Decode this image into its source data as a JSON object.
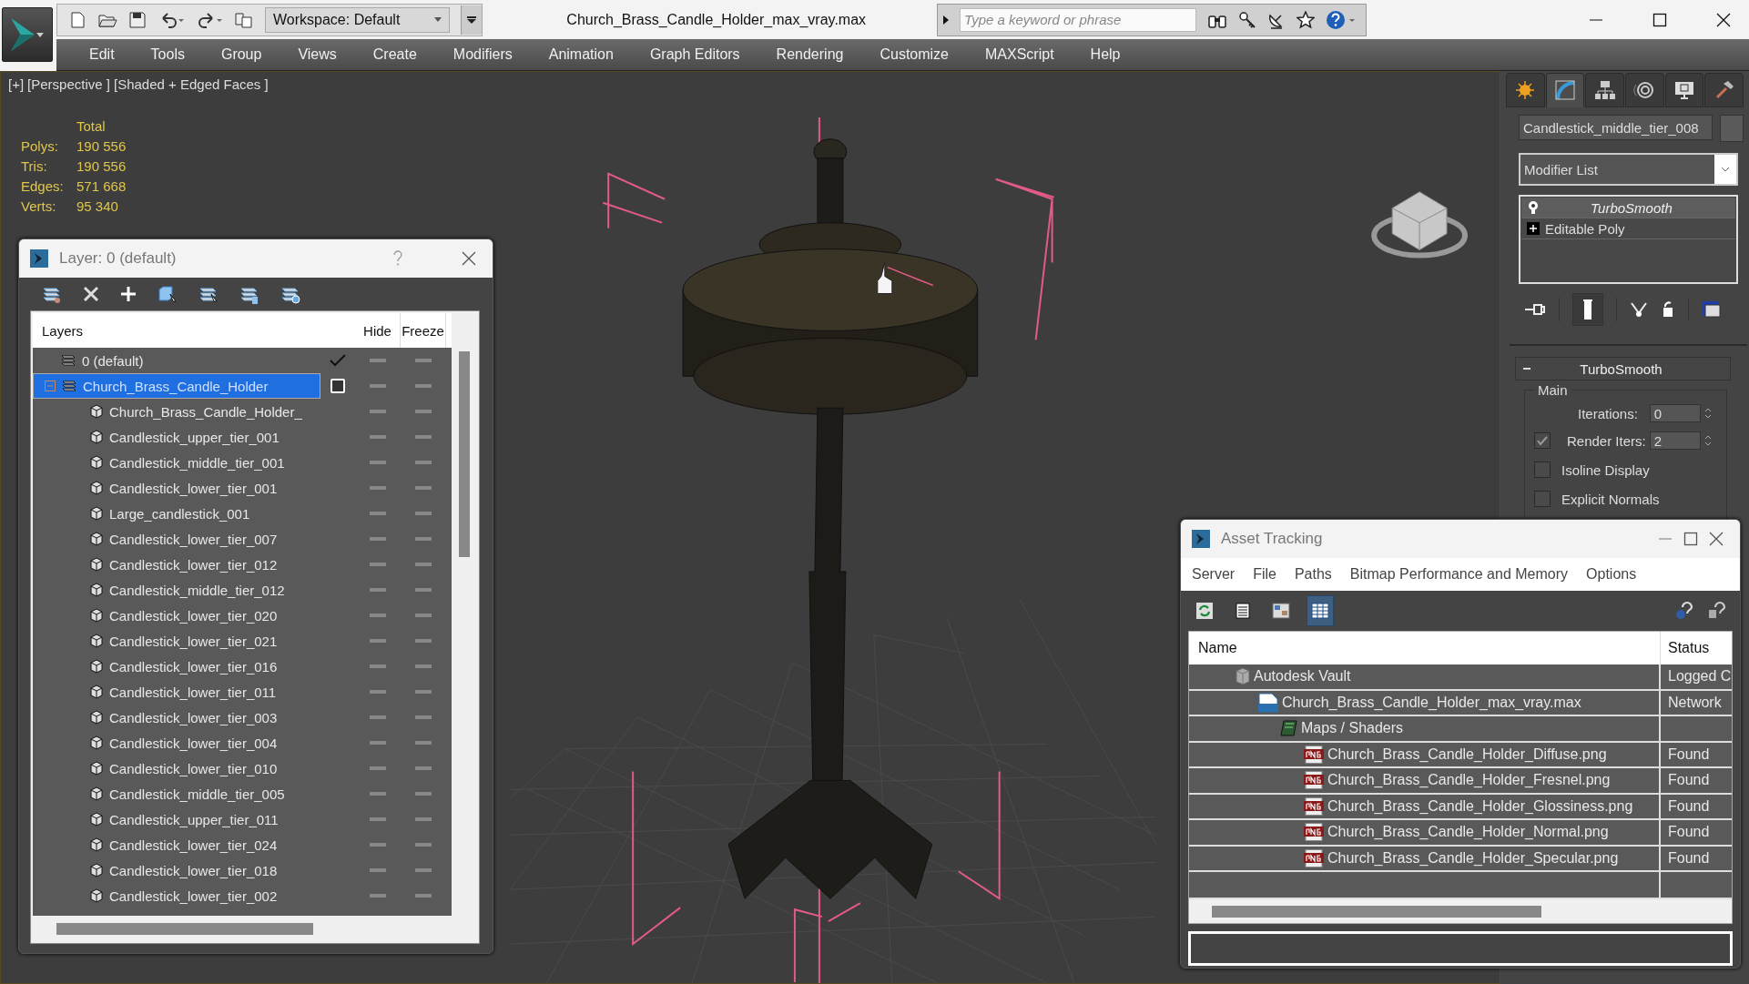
{
  "title_bar": {
    "workspace": "Workspace: Default",
    "title": "Church_Brass_Candle_Holder_max_vray.max",
    "search_placeholder": "Type a keyword or phrase"
  },
  "menu": [
    "Edit",
    "Tools",
    "Group",
    "Views",
    "Create",
    "Modifiers",
    "Animation",
    "Graph Editors",
    "Rendering",
    "Customize",
    "MAXScript",
    "Help"
  ],
  "viewport": {
    "labels": [
      "[+]",
      "[Perspective ]",
      "[Shaded + Edged Faces ]"
    ],
    "stats": {
      "heading": "Total",
      "rows": [
        {
          "label": "Polys:",
          "value": "190 556"
        },
        {
          "label": "Tris:",
          "value": "190 556"
        },
        {
          "label": "Edges:",
          "value": "571 668"
        },
        {
          "label": "Verts:",
          "value": "95 340"
        }
      ]
    }
  },
  "layer_dialog": {
    "title": "Layer: 0 (default)",
    "columns": {
      "layers": "Layers",
      "hide": "Hide",
      "freeze": "Freeze"
    },
    "layers": [
      {
        "name": "0 (default)",
        "current": true,
        "selected": false
      },
      {
        "name": "Church_Brass_Candle_Holder",
        "current": false,
        "selected": true,
        "expanded": true,
        "children": [
          {
            "name": "Church_Brass_Candle_Holder_"
          },
          {
            "name": "Candlestick_upper_tier_001"
          },
          {
            "name": "Candlestick_middle_tier_001"
          },
          {
            "name": "Candlestick_lower_tier_001"
          },
          {
            "name": "Large_candlestick_001"
          },
          {
            "name": "Candlestick_lower_tier_007"
          },
          {
            "name": "Candlestick_lower_tier_012"
          },
          {
            "name": "Candlestick_middle_tier_012"
          },
          {
            "name": "Candlestick_lower_tier_020"
          },
          {
            "name": "Candlestick_lower_tier_021"
          },
          {
            "name": "Candlestick_lower_tier_016"
          },
          {
            "name": "Candlestick_lower_tier_011"
          },
          {
            "name": "Candlestick_lower_tier_003"
          },
          {
            "name": "Candlestick_lower_tier_004"
          },
          {
            "name": "Candlestick_lower_tier_010"
          },
          {
            "name": "Candlestick_middle_tier_005"
          },
          {
            "name": "Candlestick_upper_tier_011"
          },
          {
            "name": "Candlestick_lower_tier_024"
          },
          {
            "name": "Candlestick_lower_tier_018"
          },
          {
            "name": "Candlestick_lower_tier_002"
          }
        ]
      }
    ]
  },
  "command_panel": {
    "tabs": [
      {
        "kind": "create",
        "selected": false
      },
      {
        "kind": "modify",
        "selected": true
      },
      {
        "kind": "hierarchy",
        "selected": false
      },
      {
        "kind": "motion",
        "selected": false
      },
      {
        "kind": "display",
        "selected": false
      },
      {
        "kind": "utilities",
        "selected": false
      }
    ],
    "object_name": "Candlestick_middle_tier_008",
    "modifier_list": "Modifier List",
    "stack": [
      {
        "name": "TurboSmooth",
        "kind": "modifier",
        "selected": true
      },
      {
        "name": "Editable Poly",
        "kind": "base",
        "selected": false
      }
    ],
    "rollout": {
      "title": "TurboSmooth",
      "group": "Main",
      "spinners": [
        {
          "label": "Iterations:",
          "value": "0",
          "kind": "plain"
        },
        {
          "label": "Render Iters:",
          "value": "2",
          "kind": "toggle",
          "checked": true
        }
      ],
      "checkboxes": [
        {
          "label": "Isoline Display",
          "checked": false
        },
        {
          "label": "Explicit Normals",
          "checked": false
        }
      ]
    }
  },
  "asset_tracking": {
    "title": "Asset Tracking",
    "menu": [
      "Server",
      "File",
      "Paths",
      "Bitmap Performance and Memory",
      "Options"
    ],
    "toolbar": [
      {
        "kind": "refresh",
        "selected": false
      },
      {
        "kind": "list",
        "selected": false
      },
      {
        "kind": "thumbnails",
        "selected": false
      },
      {
        "kind": "table",
        "selected": true
      }
    ],
    "columns": {
      "name": "Name",
      "status": "Status"
    },
    "rows": [
      {
        "name": "Autodesk Vault",
        "kind": "vault",
        "status": "Logged C",
        "children": [
          {
            "name": "Church_Brass_Candle_Holder_max_vray.max",
            "kind": "max",
            "status": "Network",
            "children": [
              {
                "name": "Maps / Shaders",
                "kind": "folder",
                "children": [
                  {
                    "name": "Church_Brass_Candle_Holder_Diffuse.png",
                    "kind": "png",
                    "status": "Found"
                  },
                  {
                    "name": "Church_Brass_Candle_Holder_Fresnel.png",
                    "kind": "png",
                    "status": "Found"
                  },
                  {
                    "name": "Church_Brass_Candle_Holder_Glossiness.png",
                    "kind": "png",
                    "status": "Found"
                  },
                  {
                    "name": "Church_Brass_Candle_Holder_Normal.png",
                    "kind": "png",
                    "status": "Found"
                  },
                  {
                    "name": "Church_Brass_Candle_Holder_Specular.png",
                    "kind": "png",
                    "status": "Found"
                  }
                ]
              }
            ]
          }
        ]
      }
    ]
  }
}
